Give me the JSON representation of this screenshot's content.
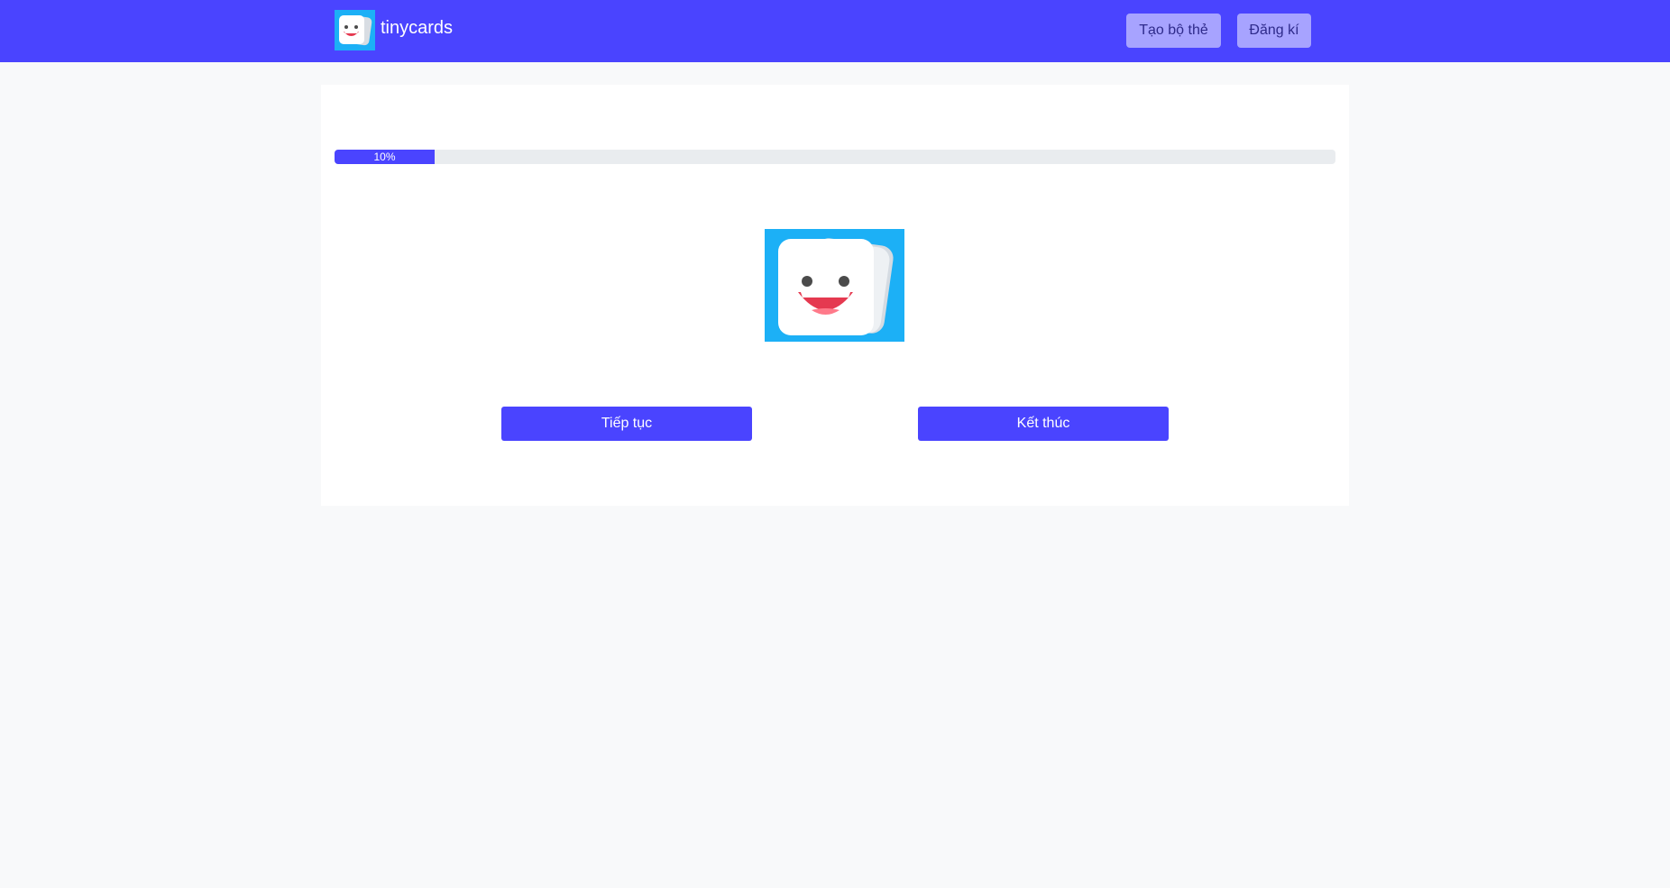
{
  "navbar": {
    "brand": "tinycards",
    "logo_icon": "tinycards-mascot-icon",
    "create_deck_label": "Tạo bộ thẻ",
    "signup_label": "Đăng kí",
    "background_color": "#4a44ff",
    "button_color": "#a7a3ff"
  },
  "study": {
    "progress_percent": 10,
    "progress_label": "10%",
    "mascot_icon": "tinycards-mascot-icon",
    "continue_label": "Tiếp tục",
    "finish_label": "Kết thúc",
    "accent_color": "#4a44ff"
  }
}
